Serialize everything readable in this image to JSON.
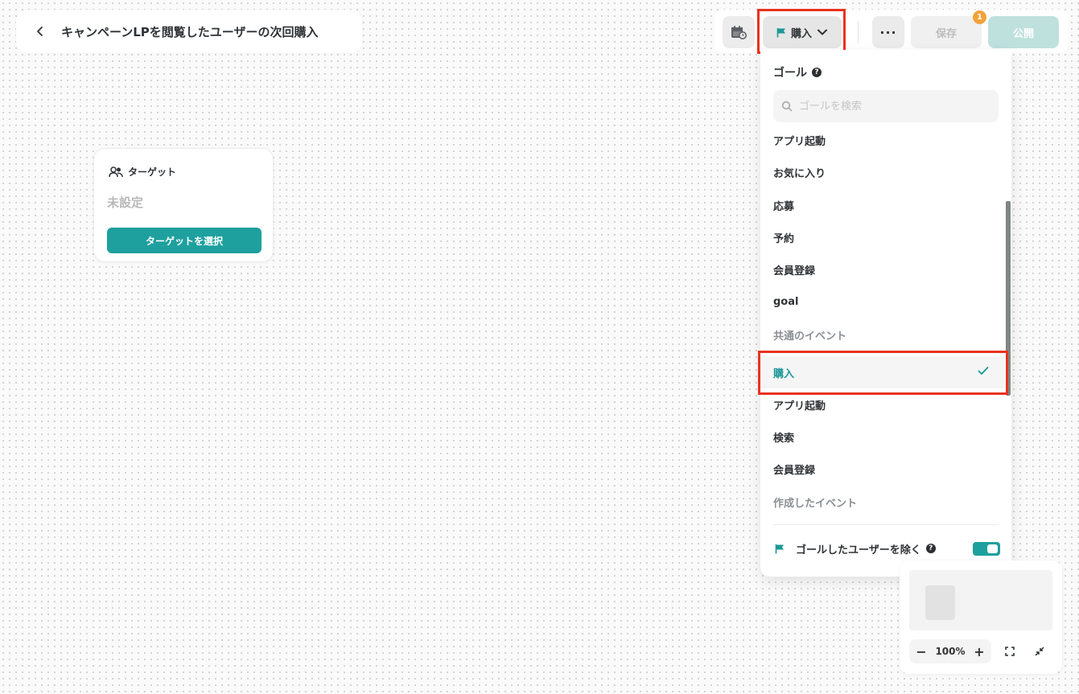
{
  "header": {
    "title": "キャンペーンLPを閲覧したユーザーの次回購入",
    "back_icon": "chevron-left-icon"
  },
  "toolbar": {
    "goal_label": "購入",
    "more_label": "···",
    "save_label": "保存",
    "save_badge": "1",
    "publish_label": "公開"
  },
  "target_card": {
    "label": "ターゲット",
    "value": "未設定",
    "select_button": "ターゲットを選択"
  },
  "goal_dropdown": {
    "heading": "ゴール",
    "search_placeholder": "ゴールを検索",
    "items": [
      {
        "label": "アプリ起動"
      },
      {
        "label": "お気に入り"
      },
      {
        "label": "応募"
      },
      {
        "label": "予約"
      },
      {
        "label": "会員登録"
      },
      {
        "label": "goal"
      }
    ],
    "common_section": "共通のイベント",
    "common_items": [
      {
        "label": "購入",
        "selected": true
      },
      {
        "label": "アプリ起動"
      },
      {
        "label": "検索"
      },
      {
        "label": "会員登録"
      }
    ],
    "created_section": "作成したイベント",
    "exclude_label": "ゴールしたユーザーを除く",
    "exclude_enabled": true
  },
  "minimap": {
    "zoom_level": "100%",
    "zoom_out": "−",
    "zoom_in": "+"
  },
  "colors": {
    "accent": "#1ea09e",
    "highlight": "#e8321e",
    "badge": "#f2a23a"
  }
}
